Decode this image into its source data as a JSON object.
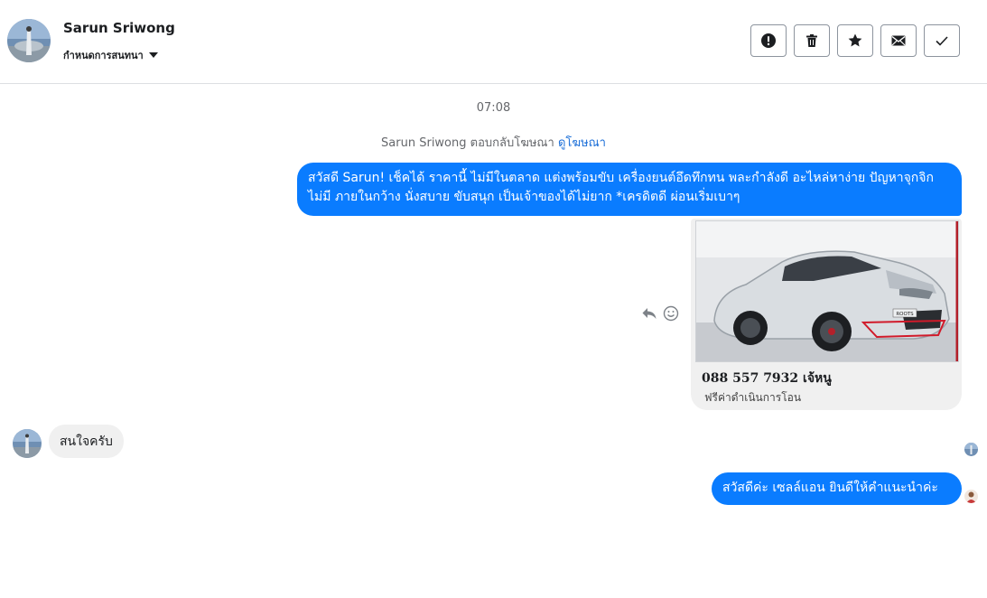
{
  "contact": {
    "name": "Sarun Sriwong",
    "settings_label": "กำหนดการสนทนา"
  },
  "toolbar": {
    "buttons": [
      {
        "name": "mark-spam-button",
        "icon": "exclamation-icon"
      },
      {
        "name": "delete-button",
        "icon": "trash-icon"
      },
      {
        "name": "star-button",
        "icon": "star-icon"
      },
      {
        "name": "mark-unread-button",
        "icon": "envelope-icon"
      },
      {
        "name": "mark-done-button",
        "icon": "checkmark-icon"
      }
    ]
  },
  "conversation": {
    "timestamp": "07:08",
    "ad_reply_text": "Sarun Sriwong ตอบกลับโฆษณา",
    "ad_reply_link": "ดูโฆษณา",
    "messages": [
      {
        "from": "page",
        "text": "สวัสดี Sarun! เช็คได้ ราคานี้ ไม่มีในตลาด แต่งพร้อมขับ เครื่องยนต์อึดทึกทน พละกำลังดี อะไหล่หาง่าย ปัญหาจุกจิกไม่มี ภายในกว้าง นั่งสบาย ขับสนุก เป็นเจ้าของได้ไม่ยาก *เครดิตดี ผ่อนเริ่มเบาๆ"
      },
      {
        "from": "customer",
        "text": "สนใจครับ"
      },
      {
        "from": "page",
        "text": "สวัสดีค่ะ เซลล์แอน ยินดีให้คำแนะนำค่ะ"
      }
    ],
    "ad_card": {
      "title": "088 557 7932 เจ้หนู",
      "subtitle": "ฟรีค่าดำเนินการโอน",
      "plate_text": "ROOTS"
    }
  },
  "colors": {
    "outgoing_bubble": "#0a7cff",
    "incoming_bubble": "#f0f0f0",
    "link": "#1a6ed8"
  }
}
